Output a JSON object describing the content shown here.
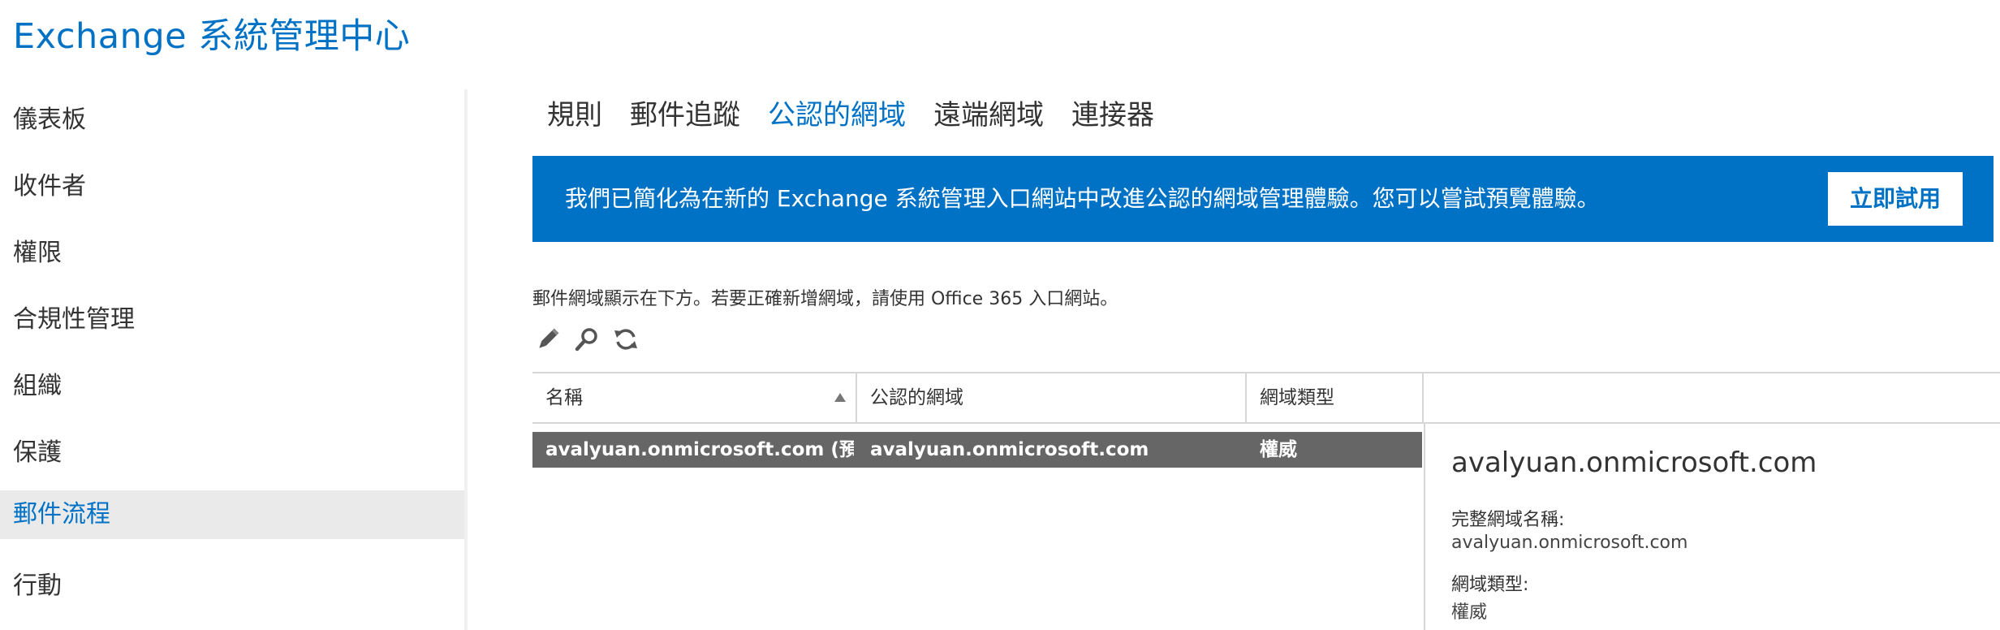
{
  "app": {
    "title": "Exchange 系統管理中心"
  },
  "sidebar": {
    "items": [
      {
        "label": "儀表板",
        "active": false
      },
      {
        "label": "收件者",
        "active": false
      },
      {
        "label": "權限",
        "active": false
      },
      {
        "label": "合規性管理",
        "active": false
      },
      {
        "label": "組織",
        "active": false
      },
      {
        "label": "保護",
        "active": false
      },
      {
        "label": "郵件流程",
        "active": true
      },
      {
        "label": "行動",
        "active": false
      }
    ]
  },
  "tabs": [
    {
      "label": "規則",
      "active": false
    },
    {
      "label": "郵件追蹤",
      "active": false
    },
    {
      "label": "公認的網域",
      "active": true
    },
    {
      "label": "遠端網域",
      "active": false
    },
    {
      "label": "連接器",
      "active": false
    }
  ],
  "banner": {
    "message": "我們已簡化為在新的 Exchange 系統管理入口網站中改進公認的網域管理體驗。您可以嘗試預覽體驗。",
    "button_label": "立即試用"
  },
  "description": "郵件網域顯示在下方。若要正確新增網域，請使用 Office 365 入口網站。",
  "toolbar": {
    "icons": [
      "edit-icon",
      "search-icon",
      "refresh-icon"
    ]
  },
  "table": {
    "columns": [
      "名稱",
      "公認的網域",
      "網域類型"
    ],
    "sort_column": "名稱",
    "sort_direction": "ascending",
    "rows": [
      {
        "name": "avalyuan.onmicrosoft.com (預設...",
        "accepted_domain": "avalyuan.onmicrosoft.com",
        "domain_type": "權威",
        "selected": true
      }
    ]
  },
  "details": {
    "title": "avalyuan.onmicrosoft.com",
    "fqdn_label": "完整網域名稱:",
    "fqdn_value": "avalyuan.onmicrosoft.com",
    "type_label": "網域類型:",
    "type_value": "權威"
  },
  "colors": {
    "accent": "#0072c6",
    "selected_row": "#666666",
    "active_nav_bg": "#eaeaea"
  }
}
